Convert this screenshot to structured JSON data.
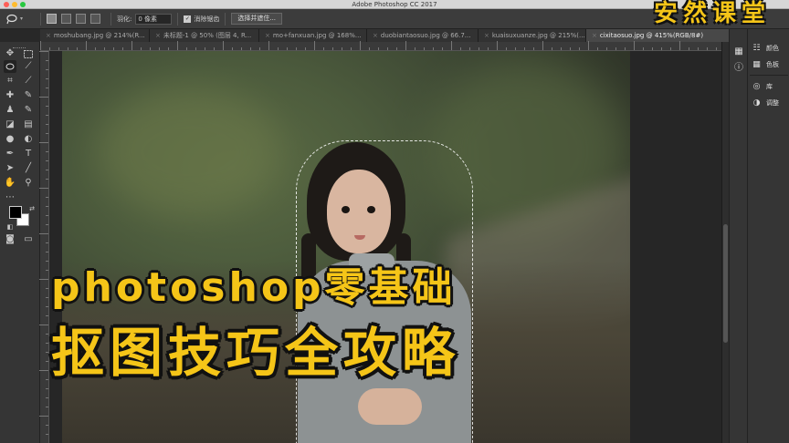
{
  "window": {
    "title": "Adobe Photoshop CC 2017"
  },
  "options_bar": {
    "feather_label": "羽化:",
    "feather_value": "0 像素",
    "antialias_label": "消除锯齿",
    "select_mask_button": "选择并遮住..."
  },
  "tabs": [
    {
      "label": "moshubang.jpg @ 214%(R...",
      "active": false
    },
    {
      "label": "未标题-1 @ 50% (图层 4, R...",
      "active": false
    },
    {
      "label": "mo+fanxuan.jpg @ 168%...",
      "active": false
    },
    {
      "label": "duobiantaosuo.jpg @ 66.7...",
      "active": false
    },
    {
      "label": "kuaisuxuanze.jpg @ 215%(...",
      "active": false
    },
    {
      "label": "cixitaosuo.jpg @ 415%(RGB/8#)",
      "active": true
    }
  ],
  "right_panels": [
    {
      "icon": "color-icon",
      "label": "颜色"
    },
    {
      "icon": "swatches-icon",
      "label": "色板"
    },
    {
      "icon": "libraries-icon",
      "label": "库"
    },
    {
      "icon": "adjustments-icon",
      "label": "调整"
    }
  ],
  "overlay": {
    "line1": "photoshop零基础",
    "line2": "抠图技巧全攻略",
    "watermark": "安然课堂"
  },
  "colors": {
    "accent_yellow": "#f5c518",
    "foreground_color": "#000000",
    "background_color": "#ffffff"
  }
}
